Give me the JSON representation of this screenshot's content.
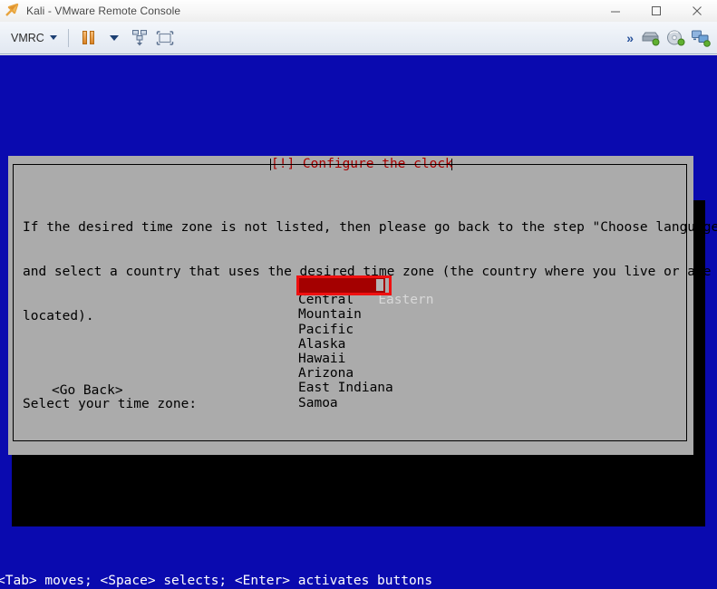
{
  "window": {
    "title": "Kali - VMware Remote Console",
    "app_icon": "vmware-remote-console-icon",
    "buttons": {
      "minimize": "Minimize",
      "maximize": "Maximize",
      "close": "Close"
    }
  },
  "toolbar": {
    "menu_label": "VMRC",
    "pause_label": "Pause",
    "pause_dropdown_label": "Power options",
    "send_keys_label": "Send Ctrl+Alt+Del",
    "fullscreen_label": "Enter full screen",
    "overflow_label": "More toolbar items",
    "devices": [
      {
        "name": "hard-disk-icon",
        "label": "Hard Disk"
      },
      {
        "name": "cd-dvd-icon",
        "label": "CD/DVD Drive"
      },
      {
        "name": "network-adapter-icon",
        "label": "Network Adapter"
      }
    ]
  },
  "console": {
    "background_color": "#0a0aaf",
    "dialog_background_color": "#ababab",
    "accent_color": "#aa0000",
    "selection_color": "#a40000",
    "annotation_color": "#ef1010",
    "dialog": {
      "title": "[!] Configure the clock",
      "paragraphs": [
        "If the desired time zone is not listed, then please go back to the step \"Choose language\"",
        "and select a country that uses the desired time zone (the country where you live or are",
        "located)."
      ],
      "prompt": "Select your time zone:",
      "timezones": [
        "Eastern",
        "Central",
        "Mountain",
        "Pacific",
        "Alaska",
        "Hawaii",
        "Arizona",
        "East Indiana",
        "Samoa"
      ],
      "selected_timezone": "Eastern",
      "selected_index": 0,
      "go_back_label": "<Go Back>"
    },
    "status_line": "<Tab> moves; <Space> selects; <Enter> activates buttons"
  }
}
